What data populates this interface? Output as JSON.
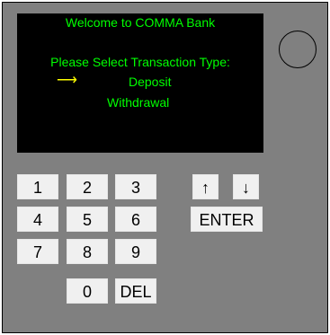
{
  "screen": {
    "welcome": "Welcome to COMMA Bank",
    "prompt": "Please Select Transaction Type:",
    "selector_arrow": "⟶",
    "options": [
      "Deposit",
      "Withdrawal"
    ]
  },
  "keypad": {
    "k1": "1",
    "k2": "2",
    "k3": "3",
    "k4": "4",
    "k5": "5",
    "k6": "6",
    "k7": "7",
    "k8": "8",
    "k9": "9",
    "k0": "0",
    "del": "DEL"
  },
  "controls": {
    "up": "↑",
    "down": "↓",
    "enter": "ENTER"
  },
  "colors": {
    "screen_text": "#00ff00",
    "arrow": "#ffff00",
    "panel": "#808080",
    "screen": "#000000"
  }
}
